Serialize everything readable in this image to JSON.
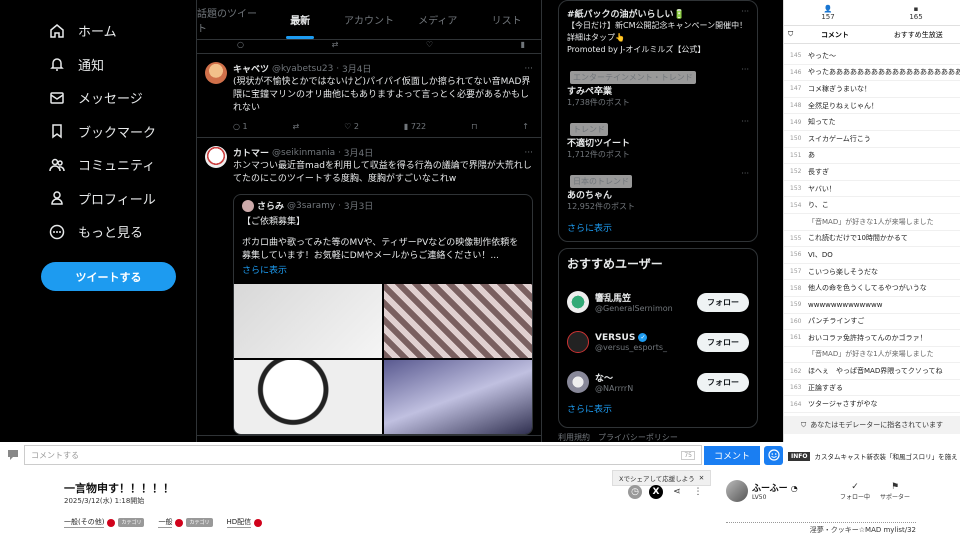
{
  "x_nav": {
    "items": [
      {
        "label": "ホーム",
        "icon": "home-icon"
      },
      {
        "label": "通知",
        "icon": "bell-icon"
      },
      {
        "label": "メッセージ",
        "icon": "mail-icon"
      },
      {
        "label": "ブックマーク",
        "icon": "bookmark-icon"
      },
      {
        "label": "コミュニティ",
        "icon": "community-icon"
      },
      {
        "label": "プロフィール",
        "icon": "profile-icon"
      },
      {
        "label": "もっと見る",
        "icon": "more-icon"
      }
    ],
    "tweet_button": "ツイートする"
  },
  "timeline": {
    "tabs": [
      "話題のツイート",
      "最新",
      "アカウント",
      "メディア",
      "リスト"
    ],
    "active_tab": "最新",
    "tweets": [
      {
        "name": "キャベツ",
        "handle": "@kyabetsu23",
        "date": "3月4日",
        "text": "(現状が不愉快とかではないけど)パイパイ仮面しか擦られてない音MAD界隈に宝鐘マリンのオリ曲他にもありますよって言っとく必要があるかもしれない",
        "replies": "1",
        "likes": "2",
        "views": "722"
      },
      {
        "name": "カトマー",
        "handle": "@seikinmania",
        "date": "3月4日",
        "text": "ホンマつい最近音madを利用して収益を得る行為の議論で界隈が大荒れしてたのにこのツイートする度胸、度胸がすごいなこれw",
        "quote": {
          "name": "さらみ",
          "handle": "@3saramy",
          "date": "3月3日",
          "heading": "【ご依頼募集】",
          "text": "ボカロ曲や歌ってみた等のMVや、ティザーPVなどの映像制作依頼を募集しています！お気軽にDMやメールからご連絡ください！...",
          "more": "さらに表示"
        }
      }
    ]
  },
  "sidebar": {
    "promo": {
      "title": "#紙パックの油がいらしい🔋",
      "text": "【今日だけ】新CM公開記念キャンペーン開催中！詳細はタップ👆",
      "by": "Promoted by J-オイルミルズ【公式】"
    },
    "trends": [
      {
        "category": "エンターテインメント・トレンド",
        "title": "すみぺ卒業",
        "count": "1,738件のポスト"
      },
      {
        "category": "トレンド",
        "title": "不適切ツイート",
        "count": "1,712件のポスト"
      },
      {
        "category": "日本のトレンド",
        "title": "あのちゃん",
        "count": "12,952件のポスト"
      }
    ],
    "show_more": "さらに表示",
    "recommend_title": "おすすめユーザー",
    "recommend": [
      {
        "name": "響乱馬笠",
        "handle": "@GeneralSernimon",
        "follow": "フォロー"
      },
      {
        "name": "VERSUS",
        "handle": "@versus_esports_",
        "follow": "フォロー",
        "verified": "✓"
      },
      {
        "name": "な〜",
        "handle": "@NArrrrN",
        "follow": "フォロー"
      }
    ],
    "footer": "利用規約　プライバシーポリシー"
  },
  "panel": {
    "viewers": "157",
    "comment_count": "165",
    "tab_comment": "コメント",
    "tab_recommend": "おすすめ生放送",
    "comments": [
      {
        "num": "145",
        "text": "やった〜"
      },
      {
        "num": "146",
        "text": "やったあああああああああああああああああああああ"
      },
      {
        "num": "147",
        "text": "コメ稼ぎうまいな！"
      },
      {
        "num": "148",
        "text": "全然足りねぇじゃん！"
      },
      {
        "num": "149",
        "text": "知ってた"
      },
      {
        "num": "150",
        "text": "スイカゲーム行こう"
      },
      {
        "num": "151",
        "text": "あ"
      },
      {
        "num": "152",
        "text": "長すぎ"
      },
      {
        "num": "153",
        "text": "ヤバい！"
      },
      {
        "num": "154",
        "text": "り、こ"
      },
      {
        "num": "",
        "text": "「音MAD」が好きな1人が来場しました",
        "sys": true
      },
      {
        "num": "155",
        "text": "これ読むだけで10時間かかるて"
      },
      {
        "num": "156",
        "text": "VI、DO"
      },
      {
        "num": "157",
        "text": "こいつら楽しそうだな"
      },
      {
        "num": "158",
        "text": "他人の命を色うくしてるやつがいうな"
      },
      {
        "num": "159",
        "text": "wwwwwwwwwwwww"
      },
      {
        "num": "160",
        "text": "パンチラインすご"
      },
      {
        "num": "161",
        "text": "おいコラァ免許持ってんのかゴラァ！"
      },
      {
        "num": "",
        "text": "「音MAD」が好きな1人が来場しました",
        "sys": true
      },
      {
        "num": "162",
        "text": "ほへぇ　やっぱ音MAD界隈ってクソってね"
      },
      {
        "num": "163",
        "text": "正論すぎる"
      },
      {
        "num": "164",
        "text": "ツタージャさすがやな"
      },
      {
        "num": "165",
        "text": "カトマーきたあああああ"
      }
    ],
    "moderator_note": "あなたはモデレーターに指名されています"
  },
  "input_bar": {
    "placeholder": "コメントする",
    "count": "75",
    "submit": "コメント"
  },
  "ticker": {
    "tag": "INFO",
    "text": "カスタムキャスト新衣装「和風ゴスロリ」を施え"
  },
  "info": {
    "title": "一言物申す！！！！！",
    "date": "2025/3/12(水) 1:18開始",
    "tags": [
      "一般(その他)",
      "一般",
      "HD配信"
    ],
    "tag_badge": "カテゴリ",
    "share_tip": "Xでシェアして応援しよう",
    "broadcaster": "ふーふー",
    "level": "LV50",
    "follow_label": "フォロー中",
    "support_label": "サポーター",
    "desc": "淫夢・クッキー☆MAD mylist/32"
  }
}
